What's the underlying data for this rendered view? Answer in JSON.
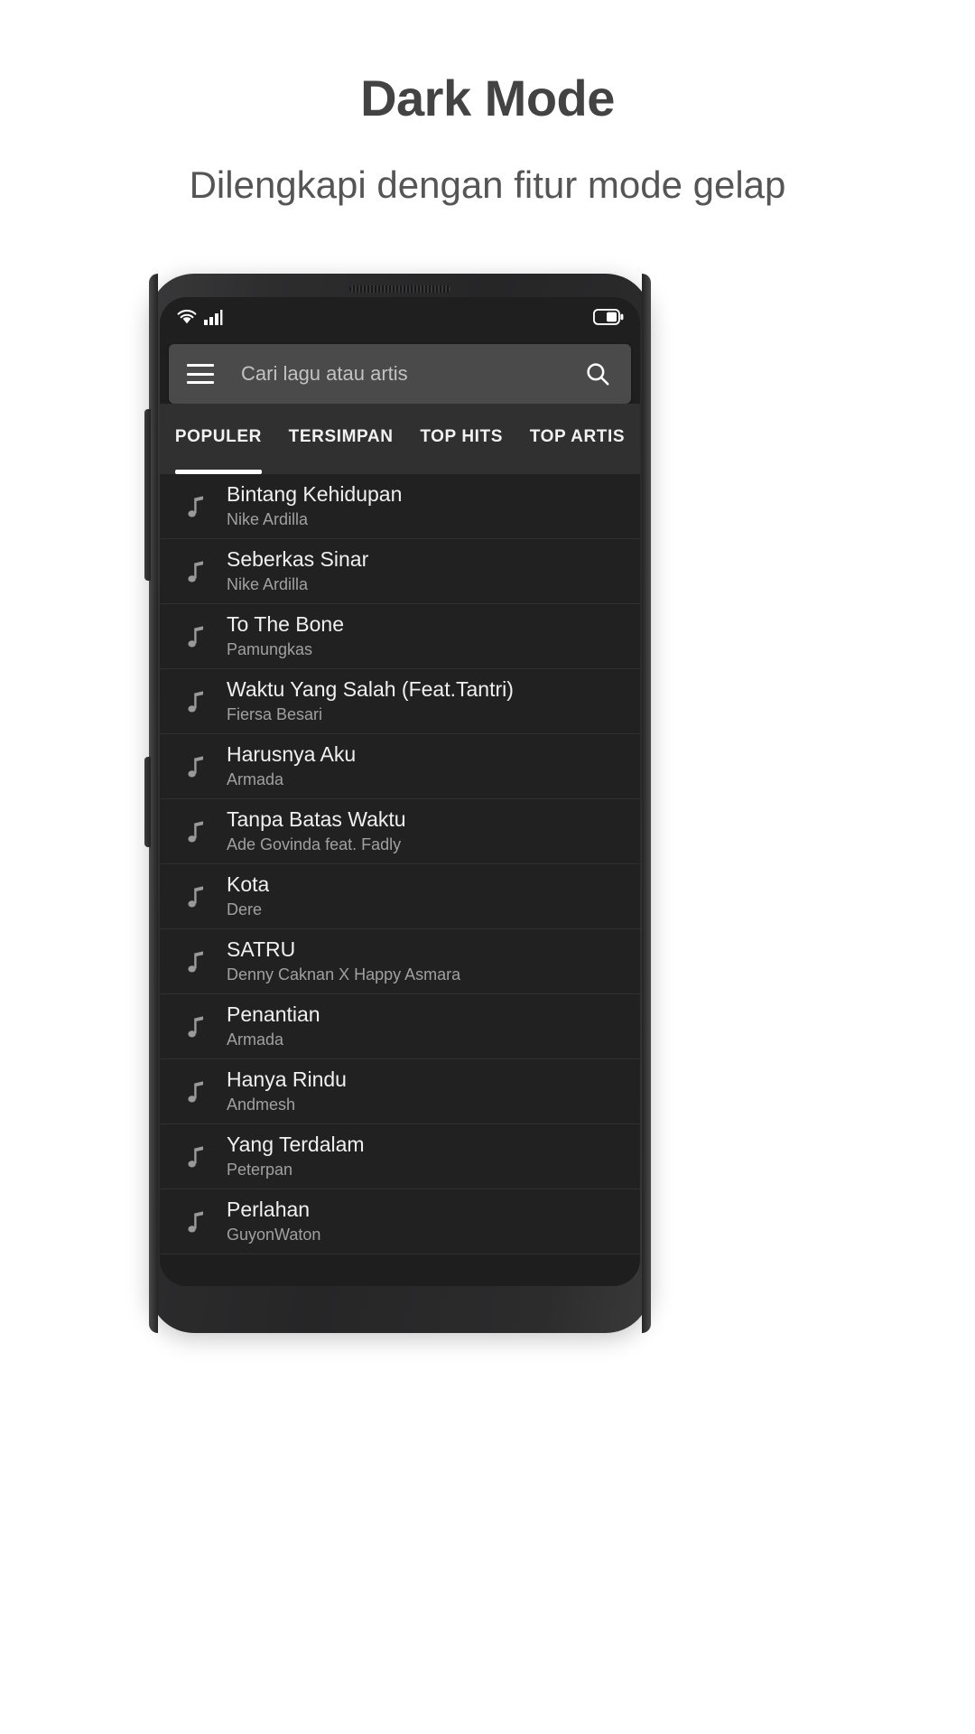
{
  "headline": {
    "title": "Dark Mode",
    "subtitle": "Dilengkapi dengan fitur mode gelap"
  },
  "colors": {
    "page_background": "#ffffff",
    "title_text": "#434343",
    "subtitle_text": "#555555",
    "phone_body": "#2d2d2e",
    "screen_background": "#1c1c1c",
    "statusbar_background": "#1f1f1f",
    "searchbar_background": "#4a4a4a",
    "tabbar_background": "#303030",
    "row_background": "#212121",
    "row_divider": "#303030",
    "title_on_dark": "#f0f0f0",
    "artist_on_dark": "#a0a0a0",
    "accent_indicator": "#ffffff"
  },
  "phone": {
    "statusbar": {
      "icons": [
        "wifi-icon",
        "signal-bars-icon",
        "battery-icon"
      ]
    },
    "search": {
      "menu_icon": "hamburger-menu-icon",
      "placeholder": "Cari lagu atau artis",
      "value": "",
      "search_icon": "search-icon"
    },
    "tabs": [
      {
        "label": "POPULER",
        "active": true
      },
      {
        "label": "TERSIMPAN",
        "active": false
      },
      {
        "label": "TOP HITS",
        "active": false
      },
      {
        "label": "TOP ARTIS",
        "active": false
      }
    ],
    "songs": [
      {
        "title": "Bintang Kehidupan",
        "artist": "Nike Ardilla"
      },
      {
        "title": "Seberkas Sinar",
        "artist": "Nike Ardilla"
      },
      {
        "title": "To The Bone",
        "artist": "Pamungkas"
      },
      {
        "title": "Waktu Yang Salah (Feat.Tantri)",
        "artist": "Fiersa Besari"
      },
      {
        "title": "Harusnya Aku",
        "artist": "Armada"
      },
      {
        "title": "Tanpa Batas Waktu",
        "artist": "Ade Govinda feat. Fadly"
      },
      {
        "title": "Kota",
        "artist": "Dere"
      },
      {
        "title": "SATRU",
        "artist": "Denny Caknan X Happy Asmara"
      },
      {
        "title": "Penantian",
        "artist": "Armada"
      },
      {
        "title": "Hanya Rindu",
        "artist": "Andmesh"
      },
      {
        "title": "Yang Terdalam",
        "artist": "Peterpan"
      },
      {
        "title": "Perlahan",
        "artist": "GuyonWaton"
      }
    ]
  }
}
